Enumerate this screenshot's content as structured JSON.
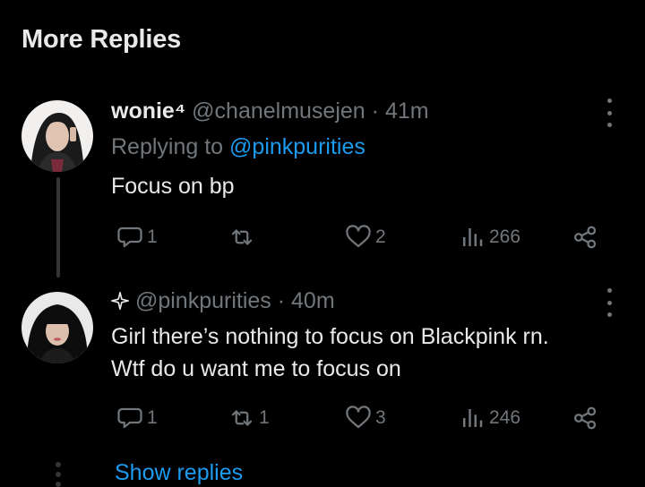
{
  "section": {
    "title": "More Replies"
  },
  "replies": [
    {
      "name": "wonie⁴",
      "handle": "@chanelmusejen",
      "dot": "·",
      "time": "41m",
      "replying_prefix": "Replying to",
      "replying_to": "@pinkpurities",
      "text_lines": [
        "Focus on bp"
      ],
      "actions": {
        "replies": "1",
        "reposts": "",
        "likes": "2",
        "views": "266"
      }
    },
    {
      "name_icon": "sparkle-icon",
      "handle": "@pinkpurities",
      "dot": "·",
      "time": "40m",
      "text_lines": [
        "Girl there’s nothing to focus on Blackpink rn.",
        "Wtf do u want me to focus on"
      ],
      "actions": {
        "replies": "1",
        "reposts": "1",
        "likes": "3",
        "views": "246"
      }
    }
  ],
  "footer": {
    "show_replies": "Show replies"
  },
  "colors": {
    "background": "#000000",
    "text": "#e7e9ea",
    "secondary": "#71767b",
    "accent": "#1d9bf0",
    "thread_line": "#333639"
  }
}
